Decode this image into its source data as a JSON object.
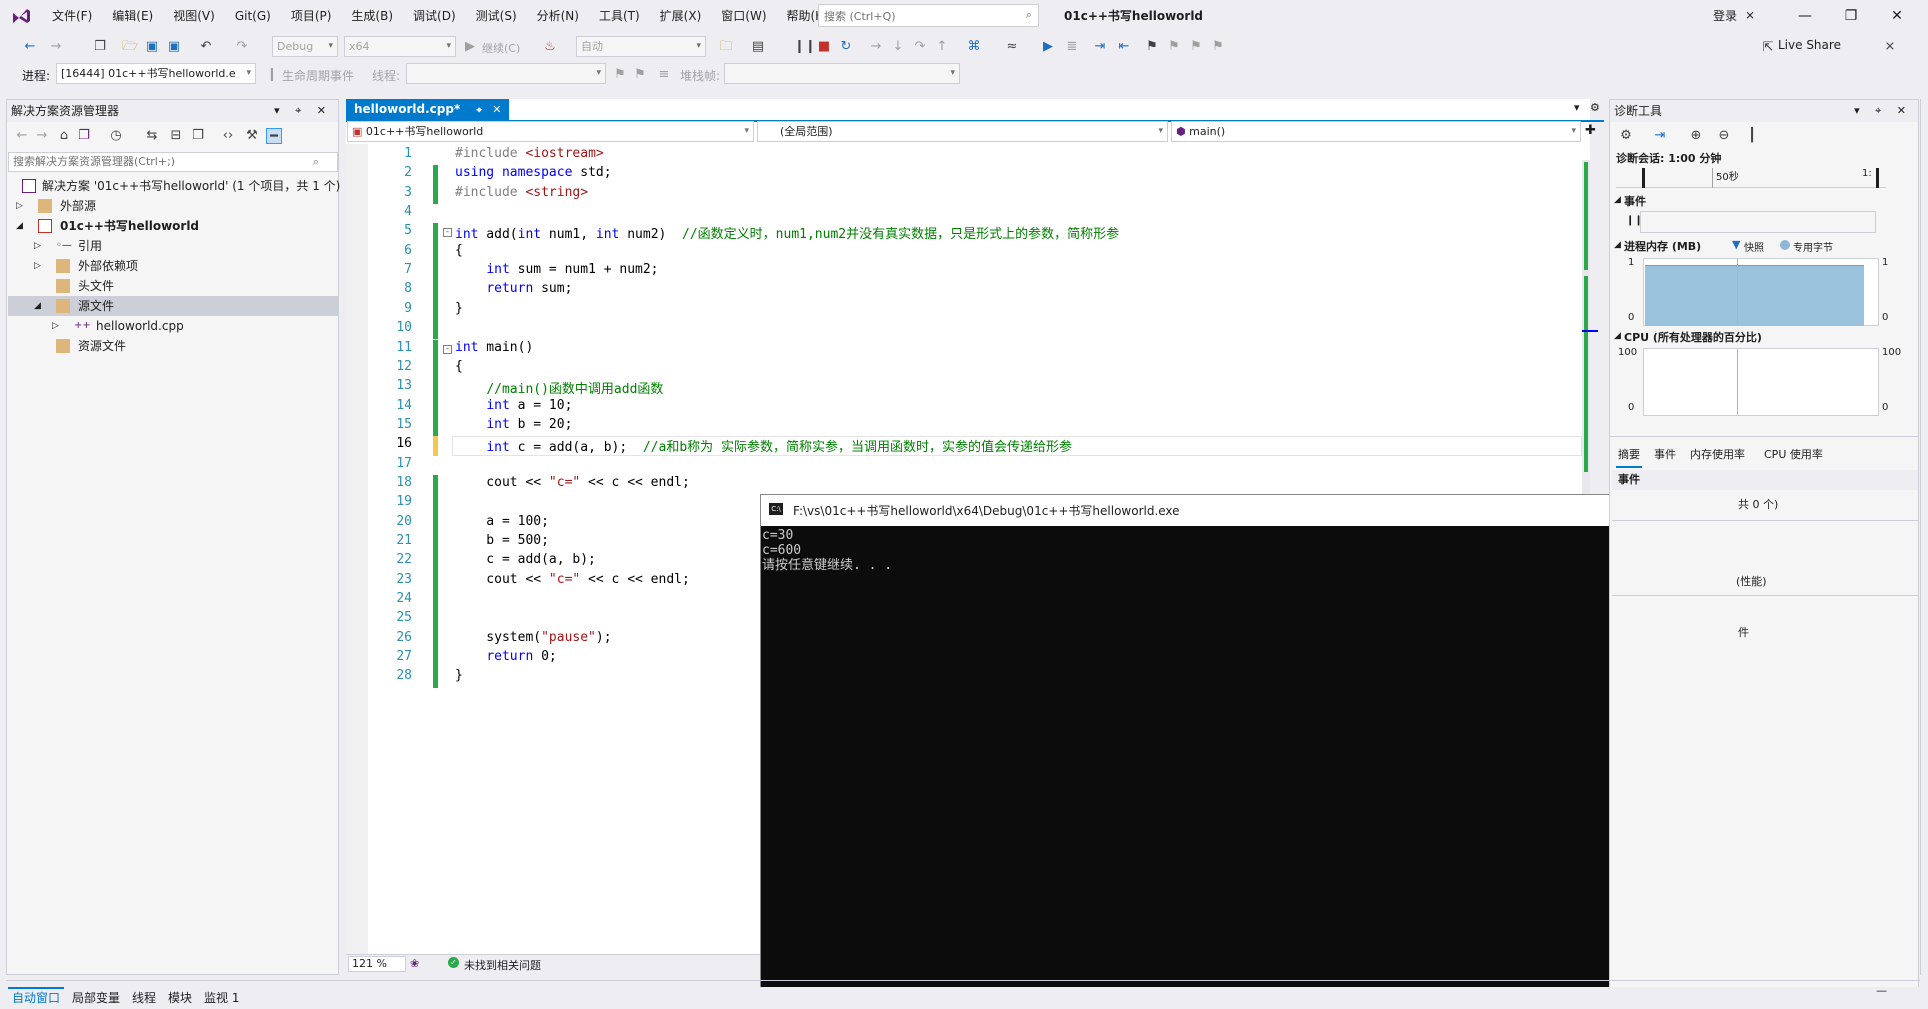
{
  "menubar": {
    "items": [
      "文件(F)",
      "编辑(E)",
      "视图(V)",
      "Git(G)",
      "项目(P)",
      "生成(B)",
      "调试(D)",
      "测试(S)",
      "分析(N)",
      "工具(T)",
      "扩展(X)",
      "窗口(W)",
      "帮助(H)"
    ],
    "search_placeholder": "搜索 (Ctrl+Q)",
    "title": "01c++书写helloworld",
    "signin": "登录"
  },
  "toolbar": {
    "config": "Debug",
    "platform": "x64",
    "continue": "继续(C)",
    "auto": "自动",
    "liveshare": "Live Share"
  },
  "toolbar2": {
    "process_label": "进程:",
    "process_value": "[16444] 01c++书写helloworld.e",
    "lifecycle": "生命周期事件",
    "thread_label": "线程:",
    "stack_label": "堆栈帧:"
  },
  "solution_explorer": {
    "title": "解决方案资源管理器",
    "search_placeholder": "搜索解决方案资源管理器(Ctrl+;)",
    "items": [
      {
        "label": "解决方案 '01c++书写helloworld' (1 个项目，共 1 个)"
      },
      {
        "label": "外部源"
      },
      {
        "label": "01c++书写helloworld"
      },
      {
        "label": "引用"
      },
      {
        "label": "外部依赖项"
      },
      {
        "label": "头文件"
      },
      {
        "label": "源文件"
      },
      {
        "label": "helloworld.cpp"
      },
      {
        "label": "资源文件"
      }
    ]
  },
  "editor": {
    "tab": "helloworld.cpp*",
    "nav_project": "01c++书写helloworld",
    "nav_scope": "(全局范围)",
    "nav_member": "main()",
    "zoom": "121 %",
    "issues": "未找到相关问题",
    "line_numbers": [
      "1",
      "2",
      "3",
      "4",
      "5",
      "6",
      "7",
      "8",
      "9",
      "10",
      "11",
      "12",
      "13",
      "14",
      "15",
      "16",
      "17",
      "18",
      "19",
      "20",
      "21",
      "22",
      "23",
      "24",
      "25",
      "26",
      "27",
      "28"
    ],
    "lines": [
      "#include <iostream>",
      "using namespace std;",
      "#include <string>",
      "",
      "int add(int num1, int num2)  //函数定义时，num1,num2并没有真实数据，只是形式上的参数，简称形参",
      "{",
      "    int sum = num1 + num2;",
      "    return sum;",
      "}",
      "",
      "int main()",
      "{",
      "    //main()函数中调用add函数",
      "    int a = 10;",
      "    int b = 20;",
      "    int c = add(a, b);  //a和b称为 实际参数，简称实参，当调用函数时，实参的值会传递给形参",
      "",
      "    cout << \"c=\" << c << endl;",
      "",
      "    a = 100;",
      "    b = 500;",
      "    c = add(a, b);",
      "    cout << \"c=\" << c << endl;",
      "",
      "",
      "    system(\"pause\");",
      "    return 0;",
      "}"
    ]
  },
  "console": {
    "title": "F:\\vs\\01c++书写helloworld\\x64\\Debug\\01c++书写helloworld.exe",
    "lines": [
      "c=30",
      "c=600",
      "请按任意键继续. . ."
    ]
  },
  "diagnostics": {
    "title": "诊断工具",
    "session": "诊断会话: 1:00 分钟",
    "tick_50s": "50秒",
    "tick_1": "1:",
    "events": "事件",
    "memory_title": "进程内存 (MB)",
    "legend_snapshot": "快照",
    "legend_private": "专用字节",
    "mem_max": "1",
    "mem_min": "0",
    "cpu_title": "CPU (所有处理器的百分比)",
    "cpu_max": "100",
    "cpu_min": "0",
    "tabs": [
      "摘要",
      "事件",
      "内存使用率",
      "CPU 使用率"
    ],
    "events_header": "事件",
    "partial1": "共 0 个)",
    "partial2": "(性能)",
    "partial3": "件"
  },
  "bottom_tabs": [
    "自动窗口",
    "局部变量",
    "线程",
    "模块",
    "监视 1"
  ]
}
